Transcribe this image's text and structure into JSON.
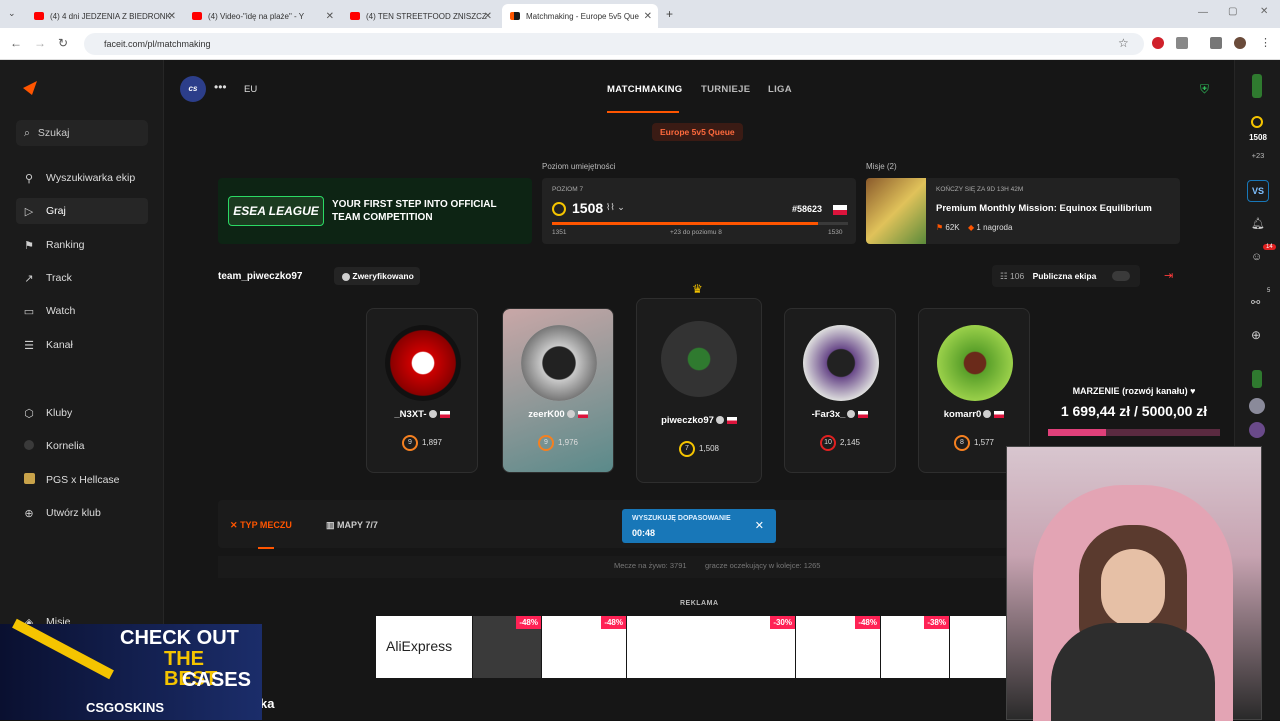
{
  "browser": {
    "tabs": [
      {
        "title": "(4) 4 dni JEDZENIA Z BIEDRONK"
      },
      {
        "title": "(4) Video-\"idę na plaże\" - Y"
      },
      {
        "title": "(4) TEN STREETFOOD ZNISZCZ"
      },
      {
        "title": "Matchmaking - Europe 5v5 Que"
      }
    ],
    "url": "faceit.com/pl/matchmaking"
  },
  "sidebar": {
    "search_label": "Szukaj",
    "items": [
      {
        "label": "Wyszukiwarka ekip",
        "icon": "team-search-icon"
      },
      {
        "label": "Graj",
        "icon": "play-icon"
      },
      {
        "label": "Ranking",
        "icon": "ranking-icon"
      },
      {
        "label": "Track",
        "icon": "track-icon"
      },
      {
        "label": "Watch",
        "icon": "watch-icon"
      },
      {
        "label": "Kanał",
        "icon": "feed-icon"
      }
    ],
    "clubs": [
      {
        "label": "Kluby",
        "icon": "clubs-icon"
      },
      {
        "label": "Kornelia",
        "icon": "avatar"
      },
      {
        "label": "PGS x Hellcase",
        "icon": "club-logo"
      },
      {
        "label": "Utwórz klub",
        "icon": "plus-circle-icon"
      }
    ],
    "missions_label": "Misje"
  },
  "header": {
    "game_logo": "cs",
    "region": "EU",
    "nav": [
      "MATCHMAKING",
      "TURNIEJE",
      "LIGA"
    ],
    "queue_name": "Europe 5v5 Queue"
  },
  "banner": {
    "league_logo": "ESEA LEAGUE",
    "text": "YOUR FIRST STEP INTO OFFICIAL TEAM COMPETITION"
  },
  "skill": {
    "title": "Poziom umiejętności",
    "level_label": "POZIOM 7",
    "elo": "1508",
    "rank": "#58623",
    "min": "1351",
    "to_next": "+23 do poziomu 8",
    "max": "1530",
    "progress": 0.9
  },
  "missions": {
    "title": "Misje (2)",
    "ends": "KOŃCZY SIĘ ZA 9D 13H 42M",
    "name": "Premium Monthly Mission: Equinox Equilibrium",
    "points": "62K",
    "reward": "1 nagroda"
  },
  "team": {
    "name": "team_piweczko97",
    "verified_label": "Zweryfikowano",
    "members_count": "106",
    "public_label": "Publiczna ekipa",
    "players": [
      {
        "name": "_N3XT-",
        "level": "9",
        "elo": "1,897"
      },
      {
        "name": "zeerK00",
        "level": "9",
        "elo": "1,976"
      },
      {
        "name": "piweczko97",
        "level": "7",
        "elo": "1,508"
      },
      {
        "name": "-Far3x_",
        "level": "10",
        "elo": "2,145"
      },
      {
        "name": "komarr0",
        "level": "8",
        "elo": "1,577"
      }
    ]
  },
  "goal": {
    "title": "MARZENIE (rozwój kanału) ♥",
    "current": "1 699,44 zł",
    "target": "5000,00 zł",
    "progress": 0.34
  },
  "controls": {
    "match_type": "TYP MECZU",
    "maps": "MAPY 7/7",
    "searching": "WYSZUKUJĘ DOPASOWANIE",
    "timer": "00:48",
    "live_matches": "Mecze na żywo: 3791",
    "queued": "gracze oczekujący w kolejce: 1265"
  },
  "ads": {
    "label": "REKLAMA",
    "brand": "AliExpress",
    "discounts": [
      "-48%",
      "-48%",
      "-30%",
      "-48%",
      "-38%"
    ]
  },
  "overlay": {
    "promo_line1": "CHECK OUT",
    "promo_line2": "THE BEST",
    "promo_line3": "CASES",
    "promo_brand": "CSGOSKINS",
    "partial_text": "ka"
  },
  "rightbar": {
    "elo": "1508",
    "delta": "+23",
    "badge1": "14",
    "badge2": "5"
  },
  "colors": {
    "accent": "#ff5500",
    "progress": "#ff6a3d",
    "search_blue": "#1877b8"
  }
}
